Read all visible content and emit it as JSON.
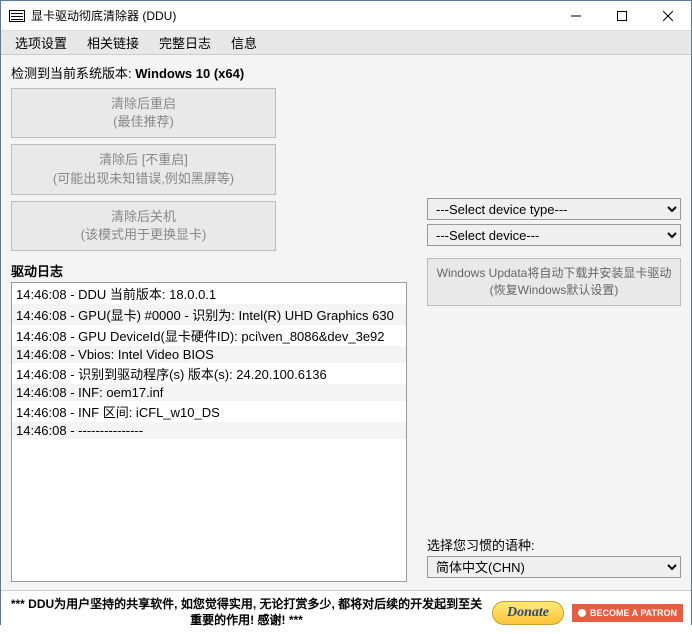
{
  "titlebar": {
    "title": "显卡驱动彻底清除器 (DDU)"
  },
  "menubar": [
    "选项设置",
    "相关链接",
    "完整日志",
    "信息"
  ],
  "sysver": {
    "prefix": "检测到当前系统版本: ",
    "version": "Windows 10 (x64)"
  },
  "buttons": {
    "clean_restart": {
      "line1": "清除后重启",
      "line2": "(最佳推荐)"
    },
    "clean_norestart": {
      "line1": "清除后 [不重启]",
      "line2": "(可能出现未知错误,例如黑屏等)"
    },
    "clean_shutdown": {
      "line1": "清除后关机",
      "line2": "(该模式用于更换显卡)"
    }
  },
  "log": {
    "label": "驱动日志",
    "entries": [
      "14:46:08 - DDU 当前版本: 18.0.0.1",
      "14:46:08 - GPU(显卡) #0000 - 识别为: Intel(R) UHD Graphics 630",
      "14:46:08 - GPU DeviceId(显卡硬件ID): pci\\ven_8086&dev_3e92",
      "14:46:08 - Vbios: Intel Video BIOS",
      "14:46:08 - 识别到驱动程序(s) 版本(s): 24.20.100.6136",
      "14:46:08 - INF: oem17.inf",
      "14:46:08 - INF 区间: iCFL_w10_DS",
      "14:46:08 - ---------------"
    ]
  },
  "selects": {
    "device_type": "---Select device type---",
    "device": "---Select device---"
  },
  "updata_btn": {
    "line1": "Windows Updata将自动下载并安装显卡驱动",
    "line2": "(恢复Windows默认设置)"
  },
  "lang": {
    "label": "选择您习惯的语种:",
    "value": "简体中文(CHN)"
  },
  "footer": {
    "text": "*** DDU为用户坚持的共享软件, 如您觉得实用, 无论打赏多少, 都将对后续的开发起到至关重要的作用! 感谢! ***",
    "donate": "Donate",
    "patron": "BECOME A PATRON"
  }
}
